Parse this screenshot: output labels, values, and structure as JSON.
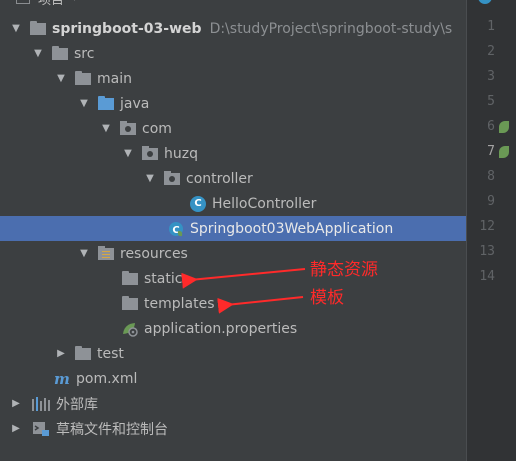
{
  "header": {
    "title": "项目"
  },
  "tree": [
    {
      "label": "springboot-03-web",
      "path": "D:\\studyProject\\springboot-study\\s"
    },
    {
      "label": "src"
    },
    {
      "label": "main"
    },
    {
      "label": "java"
    },
    {
      "label": "com"
    },
    {
      "label": "huzq"
    },
    {
      "label": "controller"
    },
    {
      "label": "HelloController"
    },
    {
      "label": "Springboot03WebApplication"
    },
    {
      "label": "resources"
    },
    {
      "label": "static"
    },
    {
      "label": "templates"
    },
    {
      "label": "application.properties"
    },
    {
      "label": "test"
    },
    {
      "label": "pom.xml"
    },
    {
      "label": "外部库"
    },
    {
      "label": "草稿文件和控制台"
    }
  ],
  "gutter": {
    "lines": [
      "1",
      "2",
      "3",
      "5",
      "6",
      "7",
      "8",
      "9",
      "12",
      "13",
      "14"
    ]
  },
  "annotations": {
    "static_note": "静态资源",
    "templates_note": "模板"
  },
  "colors": {
    "selection": "#4b6eaf",
    "annotation": "#ff2a2a",
    "panel": "#3c3f41"
  }
}
